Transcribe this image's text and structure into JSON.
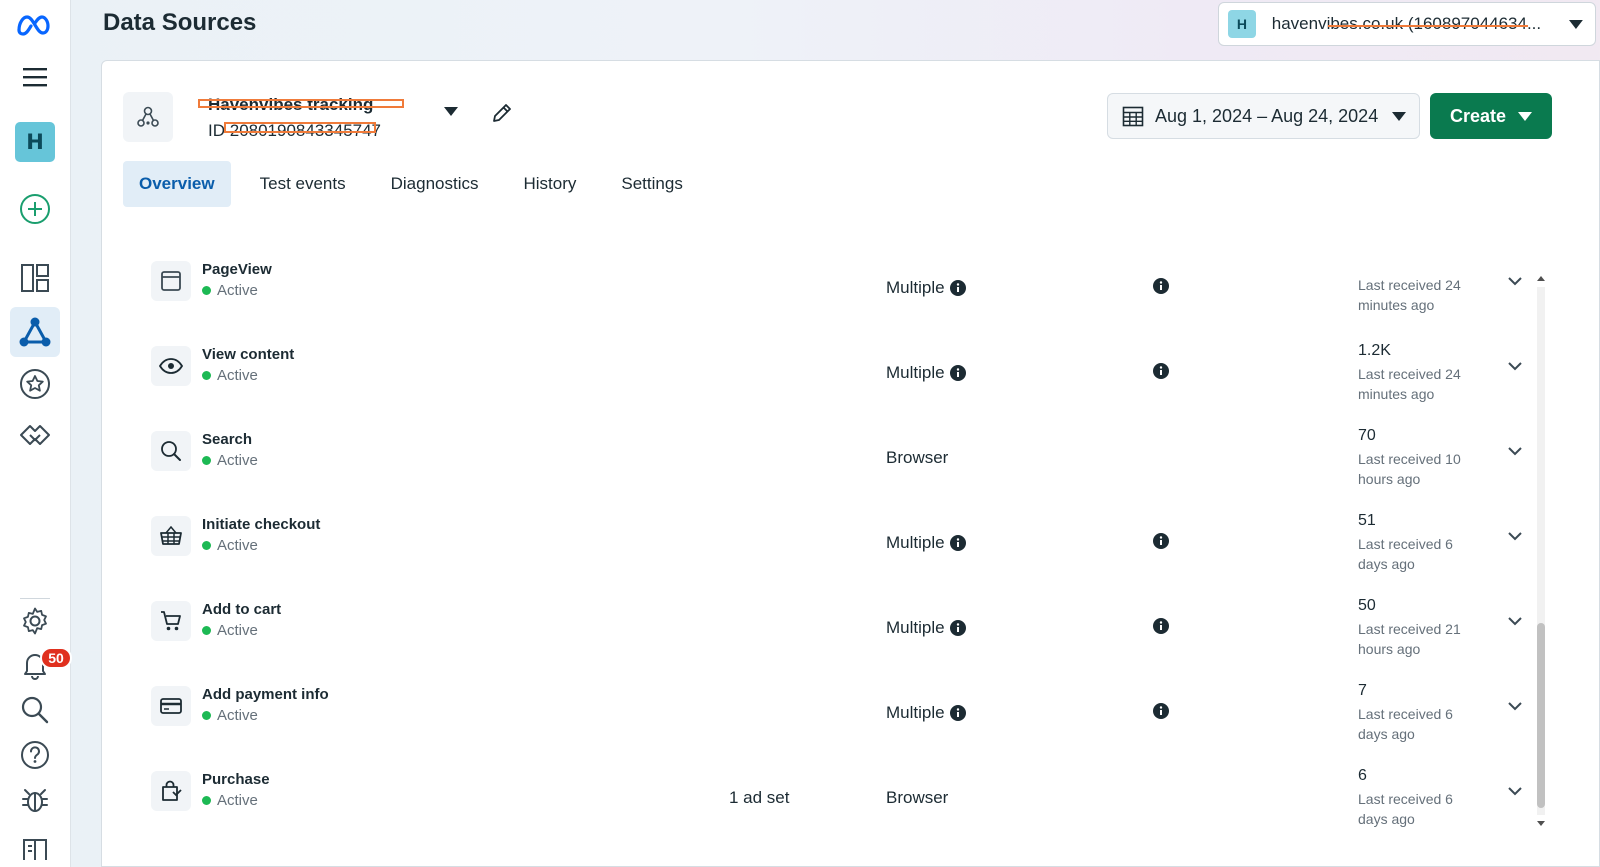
{
  "header": {
    "title": "Data Sources",
    "account": {
      "avatar_letter": "H",
      "name": "havenvibes.co.uk (160897044634..."
    }
  },
  "sidebar": {
    "account_letter": "H",
    "notifications_count": "50"
  },
  "dataset": {
    "name": "Havenvibes tracking",
    "id_label": "ID",
    "id_value": "2080190843345747"
  },
  "toolbar": {
    "date_range": "Aug 1, 2024 – Aug 24, 2024",
    "create_label": "Create"
  },
  "tabs": [
    {
      "label": "Overview",
      "active": true
    },
    {
      "label": "Test events",
      "active": false
    },
    {
      "label": "Diagnostics",
      "active": false
    },
    {
      "label": "History",
      "active": false
    },
    {
      "label": "Settings",
      "active": false
    }
  ],
  "events": [
    {
      "name": "PageView",
      "icon": "page-icon",
      "status": "Active",
      "ad_sets": "",
      "method": "Multiple",
      "count": "",
      "received_line1": "Last received 24",
      "received_line2": "minutes ago"
    },
    {
      "name": "View content",
      "icon": "eye-icon",
      "status": "Active",
      "ad_sets": "",
      "method": "Multiple",
      "count": "1.2K",
      "received_line1": "Last received 24",
      "received_line2": "minutes ago"
    },
    {
      "name": "Search",
      "icon": "search-icon",
      "status": "Active",
      "ad_sets": "",
      "method": "Browser",
      "count": "70",
      "received_line1": "Last received 10",
      "received_line2": "hours ago"
    },
    {
      "name": "Initiate checkout",
      "icon": "basket-icon",
      "status": "Active",
      "ad_sets": "",
      "method": "Multiple",
      "count": "51",
      "received_line1": "Last received 6",
      "received_line2": "days ago"
    },
    {
      "name": "Add to cart",
      "icon": "cart-icon",
      "status": "Active",
      "ad_sets": "",
      "method": "Multiple",
      "count": "50",
      "received_line1": "Last received 21",
      "received_line2": "hours ago"
    },
    {
      "name": "Add payment info",
      "icon": "credit-card-icon",
      "status": "Active",
      "ad_sets": "",
      "method": "Multiple",
      "count": "7",
      "received_line1": "Last received 6",
      "received_line2": "days ago"
    },
    {
      "name": "Purchase",
      "icon": "shopping-bag-icon",
      "status": "Active",
      "ad_sets": "1 ad set",
      "method": "Browser",
      "count": "6",
      "received_line1": "Last received 6",
      "received_line2": "days ago"
    }
  ],
  "colors": {
    "accent_blue": "#0a5dab",
    "create_green": "#0a7a4f",
    "active_dot": "#1db954",
    "badge_red": "#e0301e",
    "redaction": "#f07b3a"
  }
}
